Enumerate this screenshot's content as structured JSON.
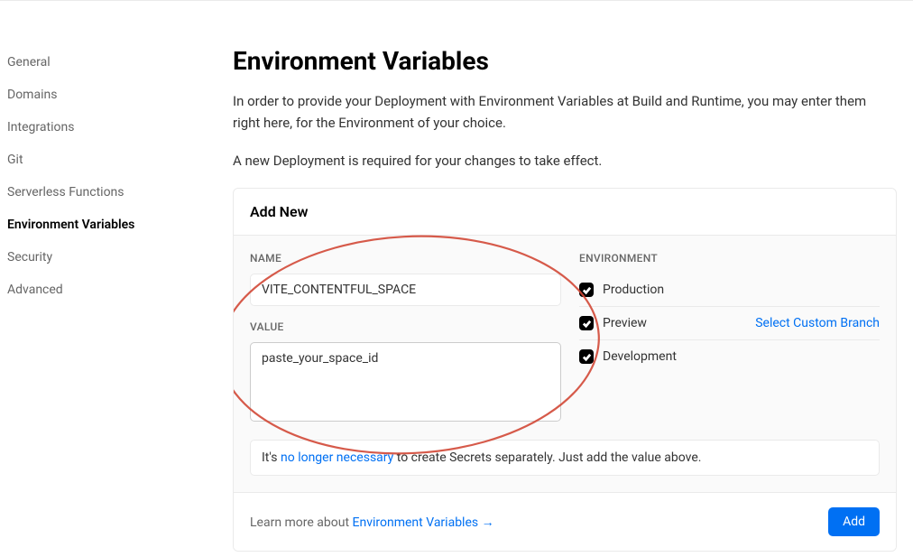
{
  "sidebar": {
    "items": [
      {
        "label": "General",
        "active": false
      },
      {
        "label": "Domains",
        "active": false
      },
      {
        "label": "Integrations",
        "active": false
      },
      {
        "label": "Git",
        "active": false
      },
      {
        "label": "Serverless Functions",
        "active": false
      },
      {
        "label": "Environment Variables",
        "active": true
      },
      {
        "label": "Security",
        "active": false
      },
      {
        "label": "Advanced",
        "active": false
      }
    ]
  },
  "page": {
    "title": "Environment Variables",
    "description1": "In order to provide your Deployment with Environment Variables at Build and Runtime, you may enter them right here, for the Environment of your choice.",
    "description2": "A new Deployment is required for your changes to take effect."
  },
  "card": {
    "header": "Add New",
    "name_label": "NAME",
    "name_value": "VITE_CONTENTFUL_SPACE",
    "value_label": "VALUE",
    "value_text": "paste_your_space_id",
    "env_label": "ENVIRONMENT",
    "environments": [
      {
        "label": "Production",
        "checked": true,
        "branch_link": ""
      },
      {
        "label": "Preview",
        "checked": true,
        "branch_link": "Select Custom Branch"
      },
      {
        "label": "Development",
        "checked": true,
        "branch_link": ""
      }
    ],
    "info_prefix": "It's ",
    "info_link": "no longer necessary",
    "info_suffix": " to create Secrets separately. Just add the value above.",
    "learn_prefix": "Learn more about ",
    "learn_link": "Environment Variables",
    "learn_arrow": " →",
    "add_button": "Add"
  }
}
